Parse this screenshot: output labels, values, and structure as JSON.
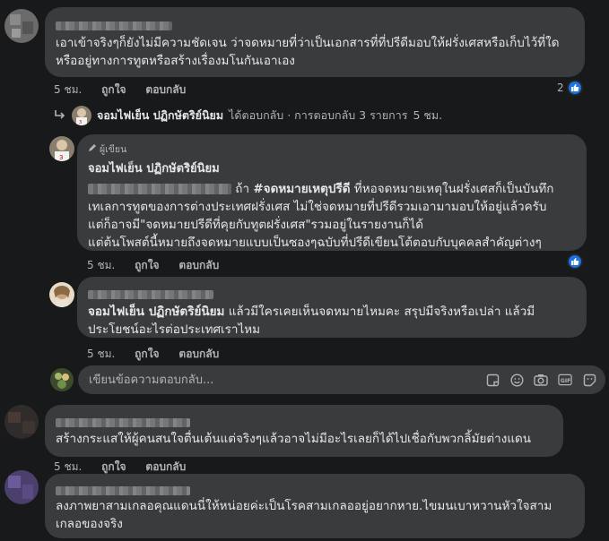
{
  "comments": [
    {
      "text": "เอาเข้าจริงๆก็ยังไม่มีความชัดเจน ว่าจดหมายที่ว่าเป็นเอกสารที่ที่ปรีดีมอบให้ฝรั่งเศสหรือเก็บไว้ที่ใดหรืออยู่ทางการทูตหรือสร้างเรื่องมโนกันเอาเอง",
      "time": "5 ชม.",
      "like": "ถูกใจ",
      "reply": "ตอบกลับ",
      "reactions": "2"
    }
  ],
  "replies_link": {
    "name": "จอมไฟเย็น ปฏิกษัตริย์นิยม",
    "text": "ได้ตอบกลับ · การตอบกลับ 3 รายการ",
    "time": "5 ชม."
  },
  "replies": [
    {
      "badge": "ผู้เขียน",
      "name": "จอมไฟเย็น ปฏิกษัตริย์นิยม",
      "line1_prefix": "ถ้า",
      "hashtag": "#จดหมายเหตุปรีดี",
      "line1_rest": "ที่หอจดหมายเหตุในฝรั่งเศสก็เป็นบันทึก",
      "line2": "เทเลการทูตของการต่างประเทศฝรั่งเศส ไม่ใช่จดหมายที่ปรีดีรวมเอามามอบให้อยู่แล้วครับ",
      "line3": "แต่ก็อาจมี\"จดหมายปรีดีที่คุยกับทูตฝรั่งเศส\"รวมอยู่ในรายงานก็ได้",
      "line4": "แต่ต้นโพสต์นี้หมายถึงจดหมายแบบเป็นซองๆฉบับที่ปรีดีเขียนโต้ตอบกับบุคคลสำคัญต่างๆ",
      "time": "5 ชม.",
      "like": "ถูกใจ",
      "reply": "ตอบกลับ"
    },
    {
      "mention": "จอมไฟเย็น ปฏิกษัตริย์นิยม",
      "text": "แล้วมีใครเคยเห็นจดหมายไหมคะ สรุปมีจริงหรือเปล่า แล้วมีประโยชน์อะไรต่อประเทศเราไหม",
      "time": "5 ชม.",
      "like": "ถูกใจ",
      "reply": "ตอบกลับ"
    }
  ],
  "reply_input": {
    "placeholder": "เขียนข้อความตอบกลับ..."
  },
  "comments2": [
    {
      "text": "สร้างกระแสให้ผู้คนสนใจตื่นเต้นแต่จริงๆแล้วอาจไม่มีอะไรเลยก็ได้ไปเชื่อกับพวกลิ้มัยต่างแดน",
      "time": "5 ชม.",
      "like": "ถูกใจ",
      "reply": "ตอบกลับ"
    },
    {
      "text": "ลงภาพยาสามเกลอคุณแดนนี่ให้หน่อยค่ะเป็นโรคสามเกลออยู่อยากหาย.ไขมนเบาหวานหัวใจสามเกลอของจริง"
    }
  ],
  "colors": {
    "bg": "#18191a",
    "bubble": "#3a3b3c",
    "text": "#e4e6eb",
    "muted": "#b0b3b8",
    "accent": "#1b74e4"
  },
  "icons": [
    "reply-arrow-icon",
    "like-thumb-icon",
    "pencil-icon",
    "sticker-icon",
    "emoji-icon",
    "camera-icon",
    "gif-icon",
    "sticker2-icon"
  ]
}
